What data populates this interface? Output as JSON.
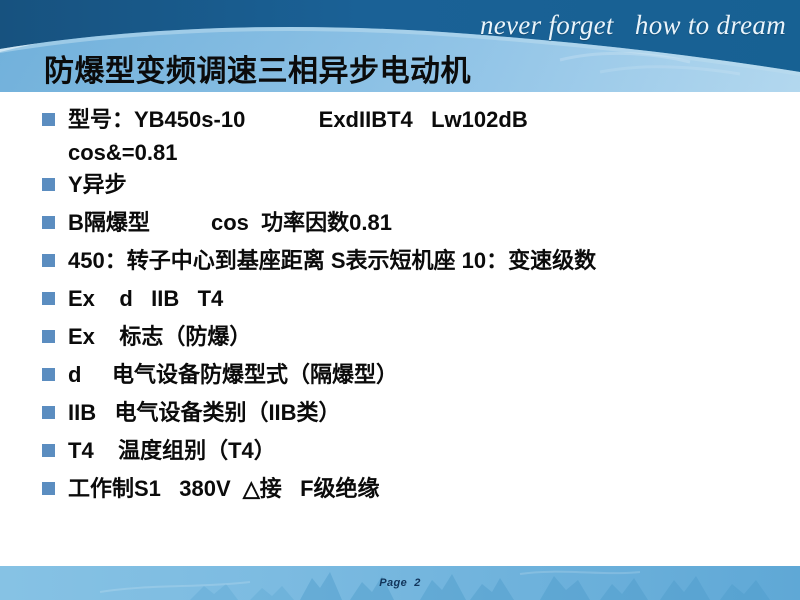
{
  "header": {
    "tagline": "never forget   how to dream",
    "title": "防爆型变频调速三相异步电动机",
    "colors": {
      "dark_blue": "#1a6196",
      "mid_blue": "#76b2dc",
      "pale_blue": "#dceaf4"
    }
  },
  "body": {
    "bullet_color": "#5b8dc0",
    "text_color": "#0b0b0b",
    "bullets": [
      {
        "line1": "型号：YB450s-10            ExdIIBT4   Lw102dB",
        "line2": "cos&=0.81"
      },
      {
        "line1": "Y异步",
        "line2": ""
      },
      {
        "line1": "B隔爆型          cos  功率因数0.81",
        "line2": ""
      },
      {
        "line1": "450：转子中心到基座距离 S表示短机座 10：变速级数",
        "line2": ""
      },
      {
        "line1": "Ex    d   IIB   T4",
        "line2": ""
      },
      {
        "line1": "Ex    标志（防爆）",
        "line2": ""
      },
      {
        "line1": "d     电气设备防爆型式（隔爆型）",
        "line2": ""
      },
      {
        "line1": "IIB   电气设备类别（IIB类）",
        "line2": ""
      },
      {
        "line1": "T4    温度组别（T4）",
        "line2": ""
      },
      {
        "line1": "工作制S1   380V  △接   F级绝缘",
        "line2": ""
      }
    ]
  },
  "footer": {
    "page_label": "Page",
    "page_number": "2",
    "band_color": "#7fbde2"
  }
}
